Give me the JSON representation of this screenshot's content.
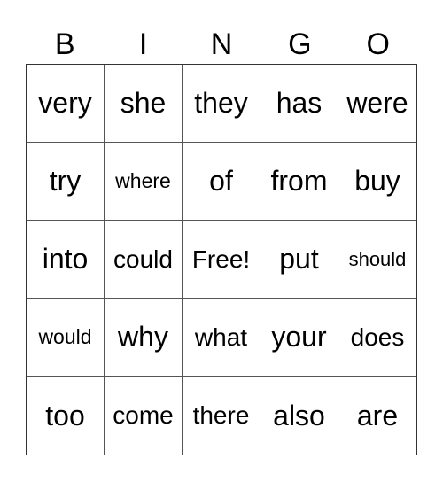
{
  "header": {
    "letters": [
      "B",
      "I",
      "N",
      "G",
      "O"
    ]
  },
  "board": {
    "rows": [
      [
        "very",
        "she",
        "they",
        "has",
        "were"
      ],
      [
        "try",
        "where",
        "of",
        "from",
        "buy"
      ],
      [
        "into",
        "could",
        "Free!",
        "put",
        "should"
      ],
      [
        "would",
        "why",
        "what",
        "your",
        "does"
      ],
      [
        "too",
        "come",
        "there",
        "also",
        "are"
      ]
    ],
    "free_space": "Free!"
  },
  "colors": {
    "text": "#000000",
    "background": "#ffffff",
    "grid_line": "#555555"
  }
}
